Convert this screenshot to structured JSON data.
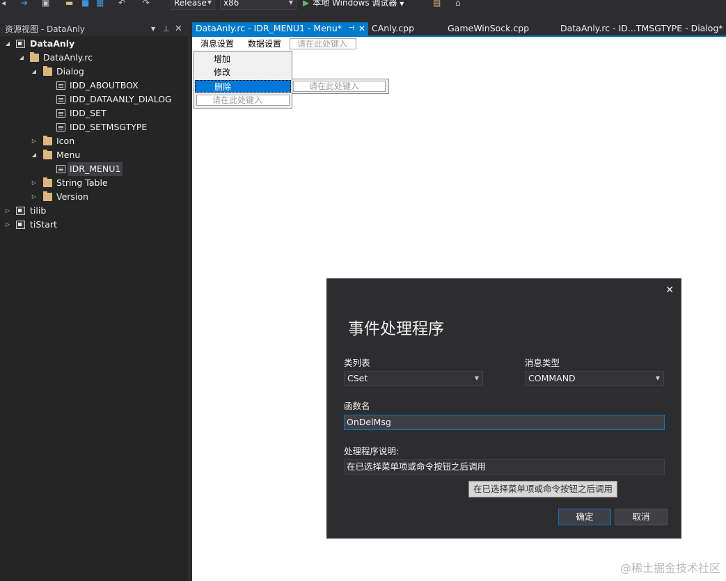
{
  "toolbar": {
    "config": "Release",
    "platform": "x86",
    "run_label": "本地 Windows 调试器"
  },
  "panel": {
    "title": "资源视图 - DataAnly",
    "tree": {
      "root": "DataAnly",
      "rc": "DataAnly.rc",
      "dialog_folder": "Dialog",
      "dialogs": [
        "IDD_ABOUTBOX",
        "IDD_DATAANLY_DIALOG",
        "IDD_SET",
        "IDD_SETMSGTYPE"
      ],
      "icon_folder": "Icon",
      "menu_folder": "Menu",
      "menu_item": "IDR_MENU1",
      "string_table": "String Table",
      "version": "Version",
      "project2": "tilib",
      "project3": "tiStart"
    }
  },
  "tabs": [
    {
      "label": "DataAnly.rc - IDR_MENU1 - Menu*",
      "active": true
    },
    {
      "label": "CAnly.cpp",
      "active": false
    },
    {
      "label": "GameWinSock.cpp",
      "active": false
    },
    {
      "label": "DataAnly.rc - ID...TMSGTYPE - Dialog*",
      "active": false
    }
  ],
  "menu_editor": {
    "top_items": [
      "消息设置",
      "数据设置"
    ],
    "placeholder": "请在此处键入",
    "dropdown_items": [
      "增加",
      "修改",
      "删除"
    ],
    "selected": "删除"
  },
  "dialog": {
    "title": "事件处理程序",
    "class_list_label": "类列表",
    "class_list_value": "CSet",
    "msg_type_label": "消息类型",
    "msg_type_value": "COMMAND",
    "func_name_label": "函数名",
    "func_name_value": "OnDelMsg",
    "desc_label": "处理程序说明:",
    "desc_value": "在已选择菜单项或命令按钮之后调用",
    "tooltip": "在已选择菜单项或命令按钮之后调用",
    "ok_label": "确定",
    "cancel_label": "取消"
  },
  "watermark": "@稀土掘金技术社区",
  "colors": {
    "accent": "#007acc",
    "panel_bg": "#252526",
    "chrome_bg": "#2d2d30",
    "folder": "#dcb67a"
  }
}
